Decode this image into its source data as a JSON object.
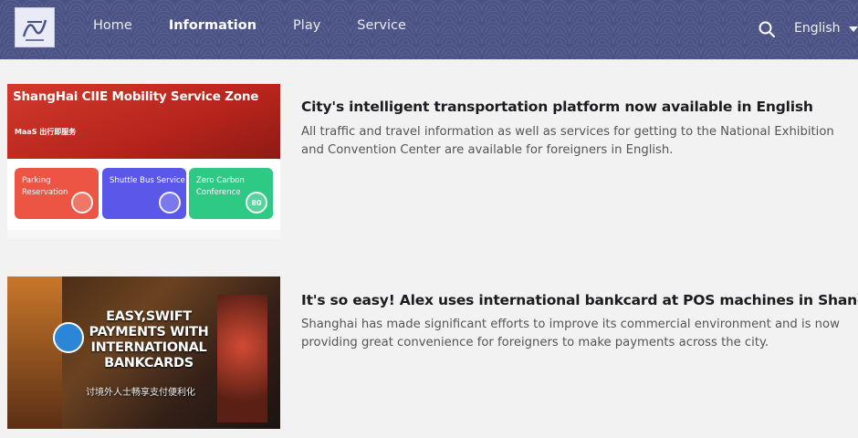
{
  "header": {
    "nav": [
      "Home",
      "Information",
      "Play",
      "Service"
    ],
    "active_nav_index": 1,
    "language": "English",
    "colors": {
      "bar": "#4b5384",
      "active_indicator": "#e05a3a"
    },
    "icons": {
      "logo": "logo-icon",
      "search": "search-icon",
      "caret": "chevron-down-icon"
    }
  },
  "articles": [
    {
      "title": "City's intelligent transportation platform now available in English",
      "description": "All traffic and travel information as well as services for getting to the National Exhibition and Convention Center are available for foreigners in English.",
      "thumbnail": {
        "banner_title": "ShangHai CIIE Mobility Service Zone",
        "brand": "MaaS 出行即服务",
        "cards": [
          "Parking Reservation",
          "Shuttle Bus Service",
          "Zero Carbon Conference"
        ],
        "card_badge": "80"
      }
    },
    {
      "title": "It's so easy! Alex uses international bankcard at POS machines in Shanghai",
      "description": "Shanghai has made significant efforts to improve its commercial environment and is now providing great convenience for foreigners to make payments across the city.",
      "thumbnail": {
        "headline_lines": [
          "EASY,SWIFT",
          "PAYMENTS WITH",
          "INTERNATIONAL",
          "BANKCARDS"
        ],
        "subtitle": "讨境外人士畅享支付便利化"
      }
    }
  ]
}
